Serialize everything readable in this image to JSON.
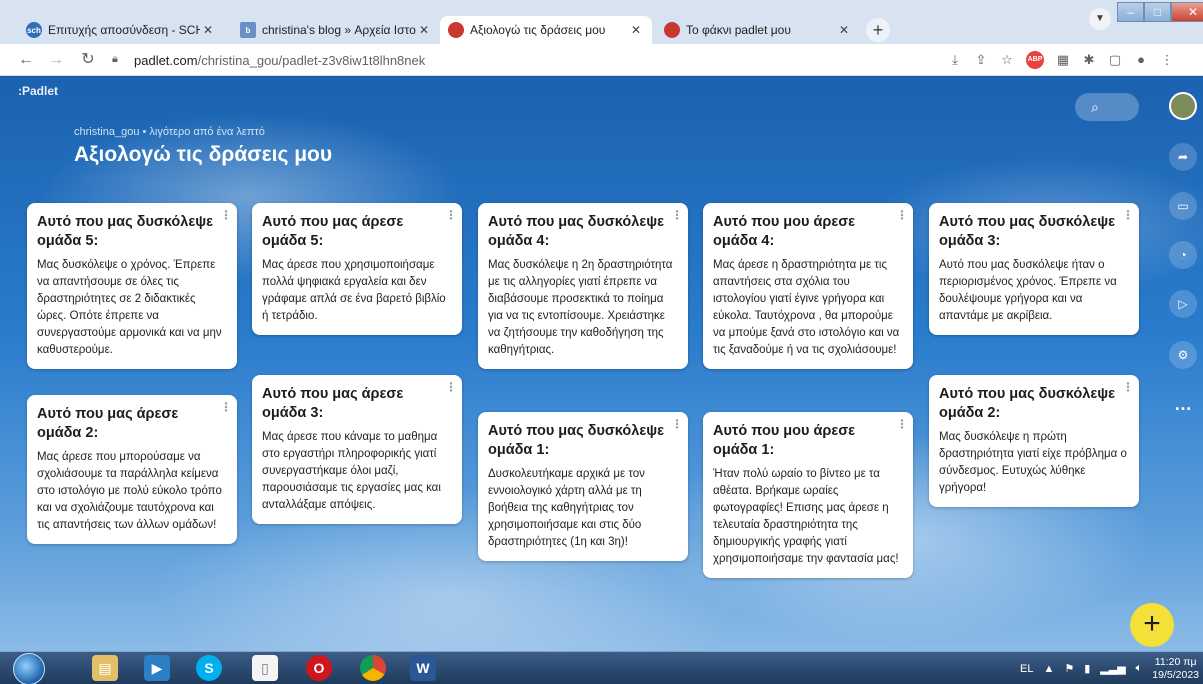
{
  "browser": {
    "tabs": [
      {
        "title": "Επιτυχής αποσύνδεση - SCH – G",
        "favicon": "sch",
        "active": false
      },
      {
        "title": "christina's blog » Αρχεία Ιστολογ",
        "favicon": "blog",
        "active": false
      },
      {
        "title": "Αξιολογώ τις δράσεις μου",
        "favicon": "padlet",
        "active": true
      },
      {
        "title": "Το φάκνι padlet μου",
        "favicon": "padlet",
        "active": false
      }
    ],
    "url_domain": "padlet.com",
    "url_path": "/christina_gou/padlet-z3v8iw1t8lhn8nek",
    "abp_label": "ABP"
  },
  "padlet": {
    "logo": ":Padlet",
    "author_line": "christina_gou • λιγότερο από ένα λεπτό",
    "title": "Αξιολογώ τις δράσεις μου"
  },
  "columns": [
    [
      {
        "title": "Αυτό που μας δυσκόλεψε ομάδα 5:",
        "body": "Μας δυσκόλεψε ο χρόνος. Έπρεπε να απαντήσουμε σε όλες τις δραστηριότητες σε 2 διδακτικές ώρες. Οπότε έπρεπε να συνεργαστούμε αρμονικά και να μην καθυστερούμε."
      },
      {
        "title": "Αυτό που μας άρεσε ομάδα 2:",
        "body": "Μας άρεσε που μπορούσαμε να σχολιάσουμε τα παράλληλα κείμενα στο ιστολόγιο με πολύ εύκολο τρόπο και να σχολιάζουμε ταυτόχρονα και τις απαντήσεις των άλλων ομάδων!"
      }
    ],
    [
      {
        "title": "Αυτό που μας άρεσε ομάδα 5:",
        "body": "Μας άρεσε που χρησιμοποιήσαμε πολλά ψηφιακά εργαλεία και δεν γράφαμε απλά σε ένα βαρετό βιβλίο ή τετράδιο."
      },
      {
        "title": "Αυτό που μας άρεσε ομάδα 3:",
        "body": "Μας άρεσε που κάναμε το μαθημα στο εργαστήρι πληροφορικής γιατί συνεργαστήκαμε όλοι μαζί, παρουσιάσαμε τις εργασίες μας και ανταλλάξαμε απόψεις."
      }
    ],
    [
      {
        "title": "Αυτό που μας δυσκόλεψε ομάδα 4:",
        "body": "Μας δυσκόλεψε η 2η δραστηριότητα με τις αλληγορίες γιατί έπρεπε να διαβάσουμε προσεκτικά το ποίημα για να τις εντοπίσουμε. Χρειάστηκε να ζητήσουμε την καθοδήγηση της καθηγήτριας."
      },
      {
        "title": "Αυτό που μας δυσκόλεψε ομάδα 1:",
        "body": "Δυσκολευτήκαμε αρχικά με τον εννοιολογικό χάρτη αλλά με τη βοήθεια της καθηγήτριας τον χρησιμοποιήσαμε και στις δύο δραστηριότητες (1η και 3η)!"
      }
    ],
    [
      {
        "title": "Αυτό που μου άρεσε ομάδα 4:",
        "body": "Μας άρεσε η δραστηριότητα με τις απαντήσεις στα σχόλια του ιστολογίου γιατί έγινε γρήγορα και εύκολα. Ταυτόχρονα , θα μπορούμε να μπούμε ξανά στο ιστολόγιο και να τις ξαναδούμε ή να τις σχολιάσουμε!"
      },
      {
        "title": "Αυτό που μου άρεσε ομάδα 1:",
        "body": "Ήταν πολύ ωραίο το βίντεο με τα αθέατα. Βρήκαμε ωραίες φωτογραφίες! Επισης μας άρεσε η τελευταία δραστηριότητα της δημιουργικής γραφής γιατί χρησιμοποιήσαμε την φαντασία μας!"
      }
    ],
    [
      {
        "title": "Αυτό που μας δυσκόλεψε ομάδα 3:",
        "body": "Αυτό που μας δυσκόλεψε ήταν ο περιορισμένος χρόνος. Έπρεπε να δουλέψουμε γρήγορα και να απαντάμε με ακρίβεια."
      },
      {
        "title": "Αυτό που μας δυσκόλεψε ομάδα 2:",
        "body": "Μας δυσκόλεψε η πρώτη δραστηριότητα γιατί είχε πρόβλημα ο σύνδεσμος. Ευτυχώς λύθηκε γρήγορα!"
      }
    ]
  ],
  "taskbar": {
    "lang": "EL",
    "time": "11:20 πμ",
    "date": "19/5/2023",
    "word_label": "W"
  },
  "colors": {
    "fab": "#f5e03a",
    "board_sky": "#2a7ccd"
  }
}
